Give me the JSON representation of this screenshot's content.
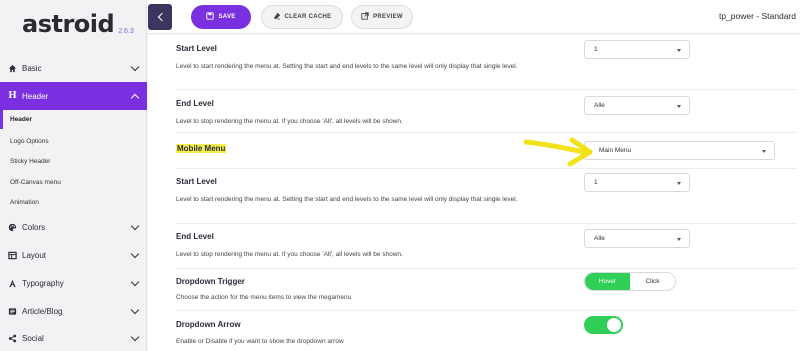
{
  "app": {
    "logo": "astroid",
    "version": "2.6.3",
    "site_title": "tp_power - Standard"
  },
  "toolbar": {
    "save_label": "SAVE",
    "clear_cache_label": "CLEAR CACHE",
    "preview_label": "PREVIEW"
  },
  "sidebar": {
    "items": [
      {
        "label": "Basic",
        "icon": "home-icon"
      },
      {
        "label": "Header",
        "icon": "heading-icon",
        "active": true
      },
      {
        "label": "Colors",
        "icon": "palette-icon"
      },
      {
        "label": "Layout",
        "icon": "layout-icon"
      },
      {
        "label": "Typography",
        "icon": "typography-icon"
      },
      {
        "label": "Article/Blog",
        "icon": "article-icon"
      },
      {
        "label": "Social",
        "icon": "share-icon"
      }
    ],
    "header_sub": [
      "Header",
      "Logo Options",
      "Sticky Header",
      "Off-Canvas menu",
      "Animation"
    ]
  },
  "form": {
    "start_level_1": {
      "label": "Start Level",
      "desc": "Level to start rendering the menu at. Setting the start and end levels to the same level will only display that single level.",
      "value": "1"
    },
    "end_level_1": {
      "label": "End Level",
      "desc": "Level to stop rendering the menu at. If you choose 'All', all levels will be shown.",
      "value": "Alle"
    },
    "mobile_menu": {
      "label": "Mobile Menu",
      "value": "Main Menu"
    },
    "start_level_2": {
      "label": "Start Level",
      "desc": "Level to start rendering the menu at. Setting the start and end levels to the same level will only display that single level.",
      "value": "1"
    },
    "end_level_2": {
      "label": "End Level",
      "desc": "Level to stop rendering the menu at. If you choose 'All', all levels will be shown.",
      "value": "Alle"
    },
    "dropdown_trigger": {
      "label": "Dropdown Trigger",
      "desc": "Choose the action for the menu items to view the megamenu",
      "options": [
        "Hover",
        "Click"
      ],
      "selected": "Hover"
    },
    "dropdown_arrow": {
      "label": "Dropdown Arrow",
      "desc": "Enable or Disable if you want to show the dropdown arrow",
      "enabled": true
    }
  },
  "colors": {
    "accent": "#7a2fe0",
    "toggle_on": "#2fcf58",
    "highlight": "#f5ef4c",
    "annotation_arrow": "#f2e21a"
  }
}
